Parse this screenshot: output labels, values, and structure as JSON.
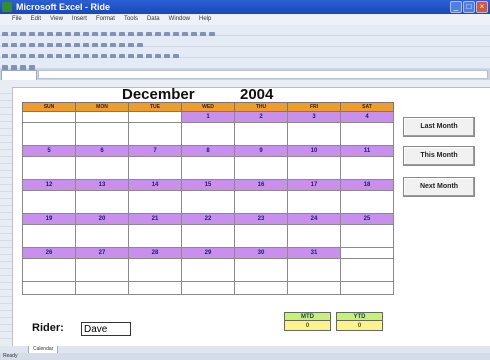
{
  "window": {
    "title": "Microsoft Excel - Ride"
  },
  "menu": [
    "File",
    "Edit",
    "View",
    "Insert",
    "Format",
    "Tools",
    "Data",
    "Window",
    "Help"
  ],
  "calendar": {
    "month": "December",
    "year": "2004",
    "weekdays": [
      "SUN",
      "MON",
      "TUE",
      "WED",
      "THU",
      "FRI",
      "SAT"
    ],
    "weeks": [
      [
        "",
        "",
        "",
        "1",
        "2",
        "3",
        "4"
      ],
      [
        "5",
        "6",
        "7",
        "8",
        "9",
        "10",
        "11"
      ],
      [
        "12",
        "13",
        "14",
        "15",
        "16",
        "17",
        "18"
      ],
      [
        "19",
        "20",
        "21",
        "22",
        "23",
        "24",
        "25"
      ],
      [
        "26",
        "27",
        "28",
        "29",
        "30",
        "31",
        ""
      ]
    ]
  },
  "buttons": {
    "last_month": "Last Month",
    "this_month": "This Month",
    "next_month": "Next Month"
  },
  "rider": {
    "label": "Rider:",
    "value": "Dave"
  },
  "totals": {
    "mtd_label": "MTD",
    "mtd_value": "0",
    "ytd_label": "YTD",
    "ytd_value": "0"
  },
  "sheet_tab": "Calendar",
  "status": "Ready"
}
